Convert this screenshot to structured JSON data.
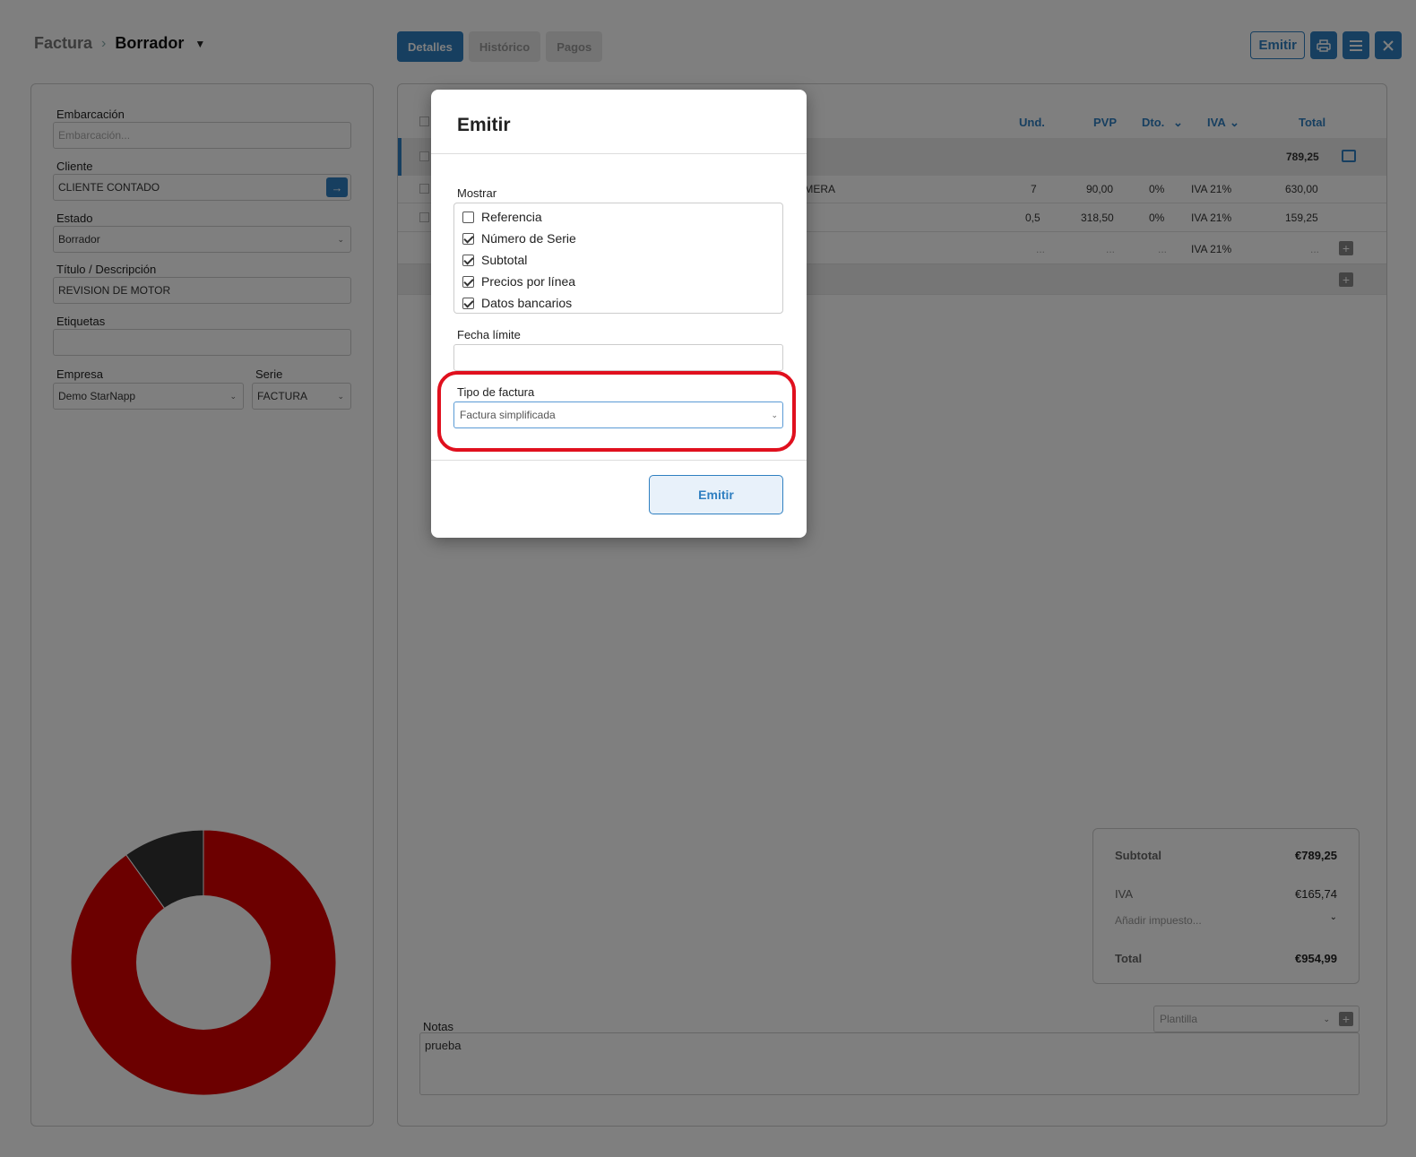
{
  "header": {
    "breadcrumb_root": "Factura",
    "breadcrumb_current": "Borrador",
    "tabs": [
      {
        "label": "Detalles",
        "active": true
      },
      {
        "label": "Histórico",
        "active": false
      },
      {
        "label": "Pagos",
        "active": false
      }
    ],
    "emit_label": "Emitir",
    "icons": [
      "print-icon",
      "menu-icon",
      "close-icon"
    ]
  },
  "left": {
    "embarcacion_label": "Embarcación",
    "embarcacion_placeholder": "Embarcación...",
    "cliente_label": "Cliente",
    "cliente_value": "CLIENTE CONTADO",
    "estado_label": "Estado",
    "estado_value": "Borrador",
    "titulo_label": "Título / Descripción",
    "titulo_value": "REVISION DE MOTOR",
    "etiquetas_label": "Etiquetas",
    "empresa_label": "Empresa",
    "empresa_value": "Demo StarNapp",
    "serie_label": "Serie",
    "serie_value": "FACTURA"
  },
  "chart_data": {
    "type": "pie",
    "values": [
      789.25,
      86.83
    ],
    "colors": [
      "#d80000",
      "#333333"
    ]
  },
  "table": {
    "headers": {
      "und": "Und.",
      "pvp": "PVP",
      "dto": "Dto.",
      "iva": "IVA",
      "total": "Total"
    },
    "group_total": "789,25",
    "rows": [
      {
        "desc_tail": "IMERA",
        "und": "7",
        "pvp": "90,00",
        "dto": "0%",
        "iva": "IVA 21%",
        "total": "630,00"
      },
      {
        "desc_tail": "",
        "und": "0,5",
        "pvp": "318,50",
        "dto": "0%",
        "iva": "IVA 21%",
        "total": "159,25"
      }
    ],
    "empty_row": {
      "und": "...",
      "pvp": "...",
      "dto": "...",
      "iva": "IVA 21%",
      "total": "..."
    }
  },
  "totals": {
    "subtotal_label": "Subtotal",
    "subtotal_value": "€789,25",
    "iva_label": "IVA",
    "iva_value": "€165,74",
    "add_tax_placeholder": "Añadir impuesto...",
    "total_label": "Total",
    "total_value": "€954,99"
  },
  "notes": {
    "label": "Notas",
    "plantilla_placeholder": "Plantilla",
    "text": "prueba"
  },
  "modal": {
    "title": "Emitir",
    "mostrar_label": "Mostrar",
    "options": [
      {
        "label": "Referencia",
        "checked": false
      },
      {
        "label": "Número de Serie",
        "checked": true
      },
      {
        "label": "Subtotal",
        "checked": true
      },
      {
        "label": "Precios por línea",
        "checked": true
      },
      {
        "label": "Datos bancarios",
        "checked": true
      }
    ],
    "fecha_label": "Fecha límite",
    "tipo_label": "Tipo de factura",
    "tipo_value": "Factura simplificada",
    "emit_button": "Emitir"
  }
}
